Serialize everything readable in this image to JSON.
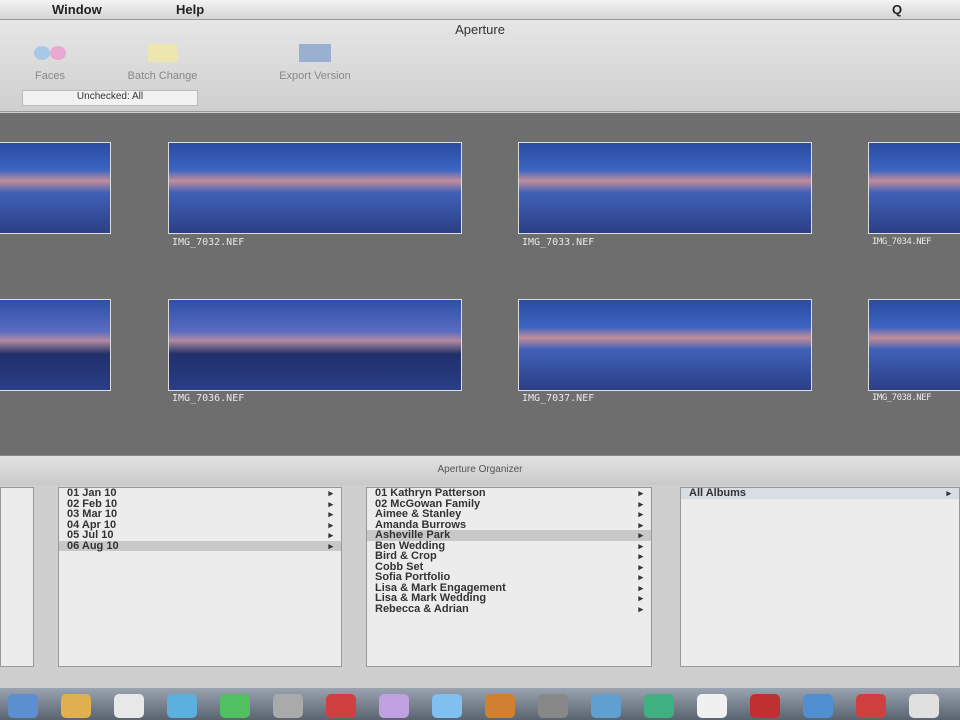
{
  "menubar": {
    "items": [
      "Window",
      "Help"
    ],
    "right": "Q"
  },
  "window": {
    "title": "Aperture"
  },
  "toolbar": {
    "buttons": [
      "Faces",
      "Batch Change",
      "Export Version"
    ]
  },
  "tab": {
    "label": "Unchecked: All"
  },
  "thumbnails": [
    {
      "caption": ""
    },
    {
      "caption": "IMG_7032.NEF"
    },
    {
      "caption": "IMG_7033.NEF"
    },
    {
      "caption": "IMG_7034.NEF"
    },
    {
      "caption": ""
    },
    {
      "caption": "IMG_7036.NEF"
    },
    {
      "caption": "IMG_7037.NEF"
    },
    {
      "caption": "IMG_7038.NEF"
    }
  ],
  "panel": {
    "title": "Aperture Organizer"
  },
  "columns": {
    "months": [
      "01 Jan 10",
      "02 Feb 10",
      "03 Mar 10",
      "04 Apr 10",
      "05 Jul 10",
      "06 Aug 10"
    ],
    "projects": [
      "01 Kathryn Patterson",
      "02 McGowan Family",
      "Aimee & Stanley",
      "Amanda Burrows",
      "Asheville Park",
      "Ben Wedding",
      "Bird & Crop",
      "Cobb Set",
      "Sofia Portfolio",
      "Lisa & Mark Engagement",
      "Lisa & Mark Wedding",
      "Rebecca & Adrian"
    ],
    "albums": [
      "All Albums"
    ]
  }
}
